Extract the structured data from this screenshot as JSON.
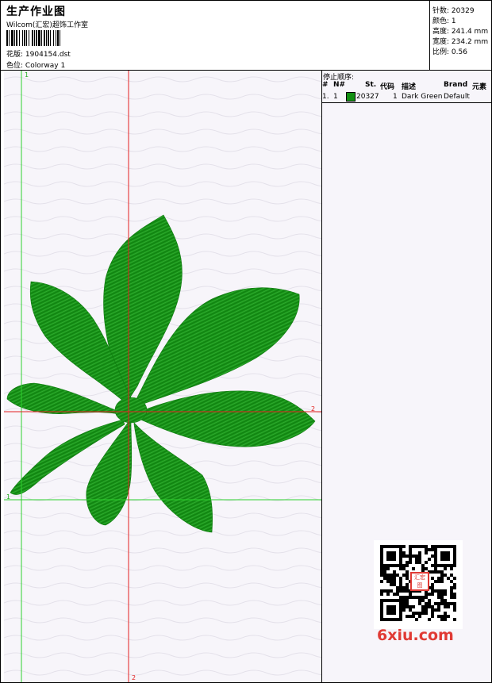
{
  "header": {
    "title": "生产作业图",
    "company": "Wilcom(汇宏)超饰工作室",
    "design_label": "花版:",
    "design_file": "1904154.dst",
    "color_label": "色位:",
    "colorway": "Colorway 1"
  },
  "stats": [
    {
      "label": "针数:",
      "value": "20329"
    },
    {
      "label": "颜色:",
      "value": "1"
    },
    {
      "label": "高度:",
      "value": "241.4 mm"
    },
    {
      "label": "宽度:",
      "value": "234.2 mm"
    },
    {
      "label": "比例:",
      "value": "0.56"
    }
  ],
  "stop_sequence": {
    "label": "停止顺序:",
    "columns": [
      "#",
      "N#",
      "St.",
      "代码",
      "描述",
      "Brand",
      "元素"
    ],
    "rows": [
      {
        "index": "1.",
        "needle": "1",
        "stitches": "20327",
        "code": "1",
        "description": "Dark Green",
        "brand": "Default",
        "element": ""
      }
    ],
    "swatch_color": "#129012"
  },
  "guides": {
    "green_marker": "1",
    "red_marker": "2"
  },
  "colors": {
    "thread": "#169416",
    "green_guide": "#2dd12d",
    "red_guide": "#e32020"
  },
  "watermark": {
    "text": "6xiu.com",
    "seal": "汇宏图"
  }
}
